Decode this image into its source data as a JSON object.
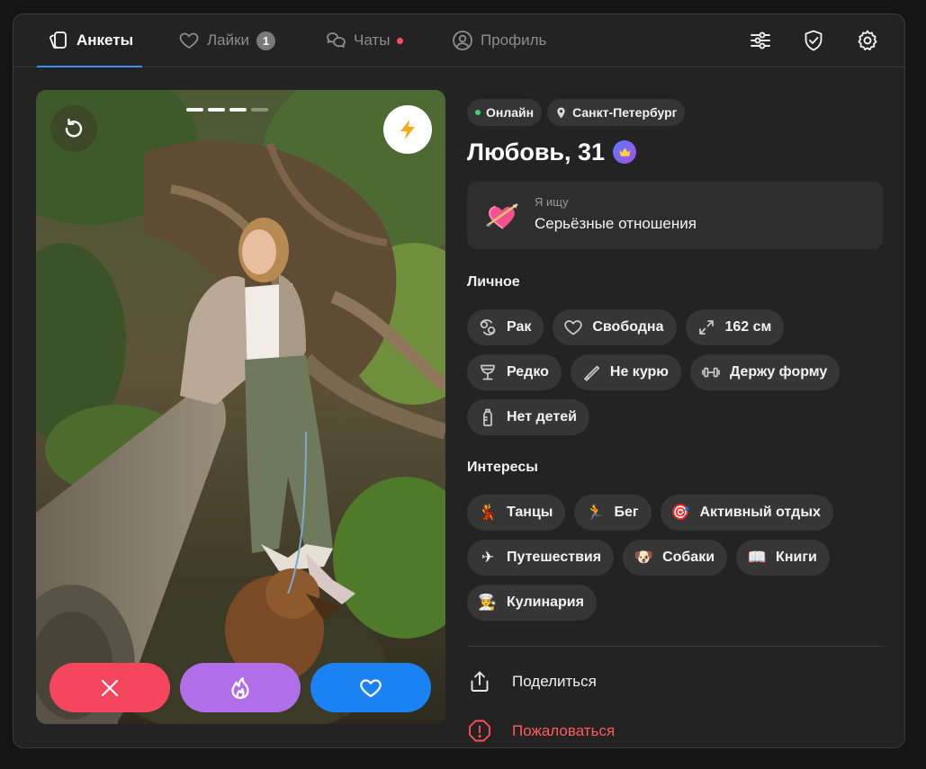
{
  "tabs": [
    {
      "label": "Анкеты",
      "icon": "cards-icon",
      "active": true
    },
    {
      "label": "Лайки",
      "icon": "heart-icon",
      "badge": "1"
    },
    {
      "label": "Чаты",
      "icon": "chat-icon",
      "dot": true
    },
    {
      "label": "Профиль",
      "icon": "user-icon"
    }
  ],
  "toolbar_icons": [
    "filters-icon",
    "shield-icon",
    "gear-icon"
  ],
  "photo": {
    "progress_total": 4,
    "progress_active": 3
  },
  "profile": {
    "status": "Онлайн",
    "city": "Санкт-Петербург",
    "name_age": "Любовь, 31",
    "looking_label": "Я ищу",
    "looking_value": "Серьёзные отношения"
  },
  "personal": {
    "title": "Личное",
    "items": [
      {
        "label": "Рак",
        "icon": "zodiac-icon"
      },
      {
        "label": "Свободна",
        "icon": "heart-outline-icon"
      },
      {
        "label": "162 см",
        "icon": "height-icon"
      },
      {
        "label": "Редко",
        "icon": "glass-icon"
      },
      {
        "label": "Не курю",
        "icon": "no-smoking-icon"
      },
      {
        "label": "Держу форму",
        "icon": "dumbbell-icon"
      },
      {
        "label": "Нет детей",
        "icon": "bottle-icon"
      }
    ]
  },
  "interests": {
    "title": "Интересы",
    "items": [
      {
        "label": "Танцы",
        "emoji": "💃"
      },
      {
        "label": "Бег",
        "emoji": "🏃"
      },
      {
        "label": "Активный отдых",
        "emoji": "🎯"
      },
      {
        "label": "Путешествия",
        "emoji": "✈"
      },
      {
        "label": "Собаки",
        "emoji": "🐶"
      },
      {
        "label": "Книги",
        "emoji": "📖"
      },
      {
        "label": "Кулинария",
        "emoji": "👩‍🍳"
      }
    ]
  },
  "actions": {
    "share": "Поделиться",
    "report": "Пожаловаться"
  },
  "colors": {
    "accent": "#3f8ef5",
    "dislike": "#f4475d",
    "superlike": "#b06ee8",
    "like": "#1b82f4",
    "report": "#ff5a5f",
    "online": "#3ed46b"
  }
}
